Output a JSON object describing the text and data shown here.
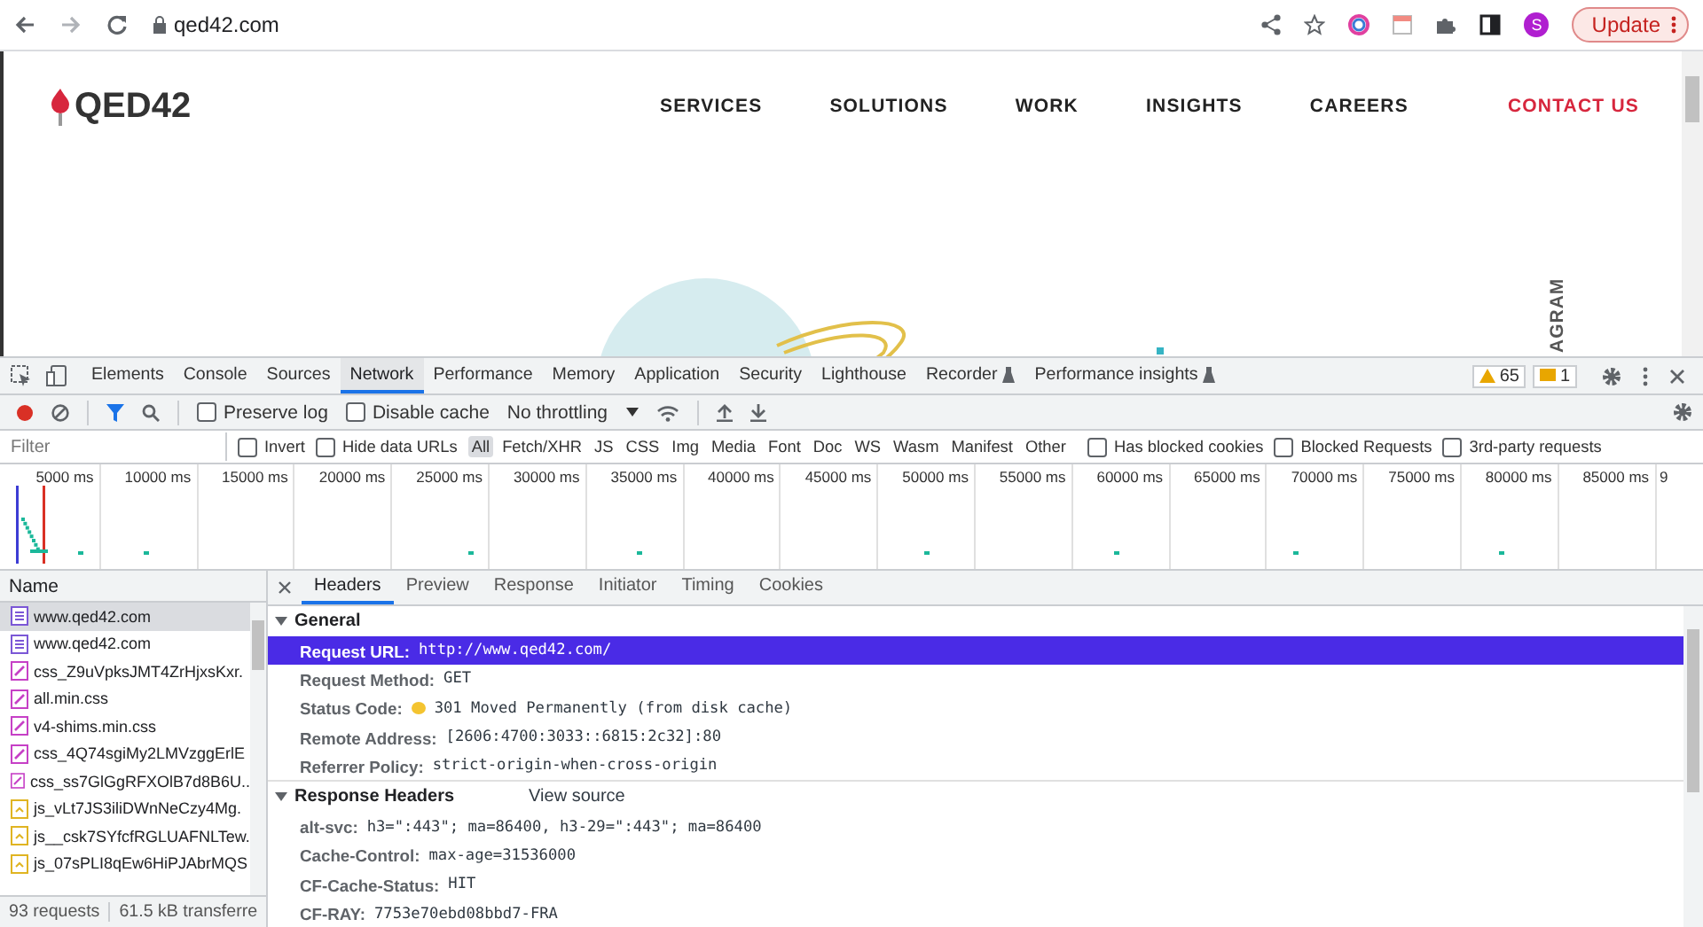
{
  "browser": {
    "url": "qed42.com",
    "profile_initial": "S",
    "update_button": "Update"
  },
  "site": {
    "logo": "QED42",
    "nav": [
      {
        "label": "SERVICES",
        "kind": "link"
      },
      {
        "label": "SOLUTIONS",
        "kind": "link"
      },
      {
        "label": "WORK",
        "kind": "link"
      },
      {
        "label": "INSIGHTS",
        "kind": "link"
      },
      {
        "label": "CAREERS",
        "kind": "link"
      },
      {
        "label": "CONTACT US",
        "kind": "cta"
      }
    ],
    "side_text": "AGRAM"
  },
  "devtools": {
    "tabs": [
      {
        "label": "Elements",
        "selected": false,
        "kind": "plain"
      },
      {
        "label": "Console",
        "selected": false,
        "kind": "plain"
      },
      {
        "label": "Sources",
        "selected": false,
        "kind": "plain"
      },
      {
        "label": "Network",
        "selected": true,
        "kind": "plain"
      },
      {
        "label": "Performance",
        "selected": false,
        "kind": "plain"
      },
      {
        "label": "Memory",
        "selected": false,
        "kind": "plain"
      },
      {
        "label": "Application",
        "selected": false,
        "kind": "plain"
      },
      {
        "label": "Security",
        "selected": false,
        "kind": "plain"
      },
      {
        "label": "Lighthouse",
        "selected": false,
        "kind": "plain"
      },
      {
        "label": "Recorder",
        "selected": false,
        "kind": "experimental"
      },
      {
        "label": "Performance insights",
        "selected": false,
        "kind": "experimental"
      }
    ],
    "warning_count": "65",
    "issue_count": "1",
    "network_toolbar": {
      "recording": true,
      "options": [
        {
          "label": "Preserve log",
          "checked": false
        },
        {
          "label": "Disable cache",
          "checked": false
        }
      ],
      "throttling": "No throttling"
    },
    "filter_bar": {
      "placeholder": "Filter",
      "options": [
        {
          "label": "Invert",
          "checked": false
        },
        {
          "label": "Hide data URLs",
          "checked": false
        }
      ],
      "types": [
        {
          "label": "All",
          "selected": true
        },
        {
          "label": "Fetch/XHR",
          "selected": false
        },
        {
          "label": "JS",
          "selected": false
        },
        {
          "label": "CSS",
          "selected": false
        },
        {
          "label": "Img",
          "selected": false
        },
        {
          "label": "Media",
          "selected": false
        },
        {
          "label": "Font",
          "selected": false
        },
        {
          "label": "Doc",
          "selected": false
        },
        {
          "label": "WS",
          "selected": false
        },
        {
          "label": "Wasm",
          "selected": false
        },
        {
          "label": "Manifest",
          "selected": false
        },
        {
          "label": "Other",
          "selected": false
        }
      ],
      "extra_options": [
        {
          "label": "Has blocked cookies",
          "checked": false
        },
        {
          "label": "Blocked Requests",
          "checked": false
        },
        {
          "label": "3rd-party requests",
          "checked": false
        }
      ]
    },
    "overview": {
      "ticks": [
        "5000 ms",
        "10000 ms",
        "15000 ms",
        "20000 ms",
        "25000 ms",
        "30000 ms",
        "35000 ms",
        "40000 ms",
        "45000 ms",
        "50000 ms",
        "55000 ms",
        "60000 ms",
        "65000 ms",
        "70000 ms",
        "75000 ms",
        "80000 ms",
        "85000 ms",
        "9"
      ]
    },
    "requests": {
      "column": "Name",
      "rows": [
        {
          "name": "www.qed42.com",
          "kind": "document",
          "selected": true
        },
        {
          "name": "www.qed42.com",
          "kind": "document",
          "selected": false
        },
        {
          "name": "css_Z9uVpksJMT4ZrHjxsKxr.",
          "kind": "stylesheet",
          "selected": false
        },
        {
          "name": "all.min.css",
          "kind": "stylesheet",
          "selected": false
        },
        {
          "name": "v4-shims.min.css",
          "kind": "stylesheet",
          "selected": false
        },
        {
          "name": "css_4Q74sgiMy2LMVzggErlE",
          "kind": "stylesheet",
          "selected": false
        },
        {
          "name": "css_ss7GlGgRFXOlB7d8B6U..",
          "kind": "stylesheet",
          "selected": false
        },
        {
          "name": "js_vLt7JS3iliDWnNeCzy4Mg.",
          "kind": "script",
          "selected": false
        },
        {
          "name": "js__csk7SYfcfRGLUAFNLTew.",
          "kind": "script",
          "selected": false
        },
        {
          "name": "js_07sPLI8qEw6HiPJAbrMQS",
          "kind": "script",
          "selected": false
        }
      ],
      "summary": [
        "93 requests",
        "61.5 kB transferre"
      ]
    },
    "details": {
      "tabs": [
        {
          "label": "Headers",
          "selected": true
        },
        {
          "label": "Preview",
          "selected": false
        },
        {
          "label": "Response",
          "selected": false
        },
        {
          "label": "Initiator",
          "selected": false
        },
        {
          "label": "Timing",
          "selected": false
        },
        {
          "label": "Cookies",
          "selected": false
        }
      ],
      "sections": [
        {
          "title": "General",
          "expanded": true,
          "rows": [
            {
              "key": "Request URL:",
              "value": "http://www.qed42.com/",
              "kind": "plain",
              "selected": true
            },
            {
              "key": "Request Method:",
              "value": "GET",
              "kind": "plain",
              "selected": false
            },
            {
              "key": "Status Code:",
              "value": "301 Moved Permanently (from disk cache)",
              "kind": "status",
              "selected": false
            },
            {
              "key": "Remote Address:",
              "value": "[2606:4700:3033::6815:2c32]:80",
              "kind": "plain",
              "selected": false
            },
            {
              "key": "Referrer Policy:",
              "value": "strict-origin-when-cross-origin",
              "kind": "plain",
              "selected": false
            }
          ]
        },
        {
          "title": "Response Headers",
          "expanded": true,
          "link": "View source",
          "rows": [
            {
              "key": "alt-svc:",
              "value": "h3=\":443\"; ma=86400, h3-29=\":443\"; ma=86400",
              "kind": "plain",
              "selected": false
            },
            {
              "key": "Cache-Control:",
              "value": "max-age=31536000",
              "kind": "plain",
              "selected": false
            },
            {
              "key": "CF-Cache-Status:",
              "value": "HIT",
              "kind": "plain",
              "selected": false
            },
            {
              "key": "CF-RAY:",
              "value": "7753e70ebd08bbd7-FRA",
              "kind": "plain",
              "selected": false
            }
          ]
        }
      ]
    }
  }
}
